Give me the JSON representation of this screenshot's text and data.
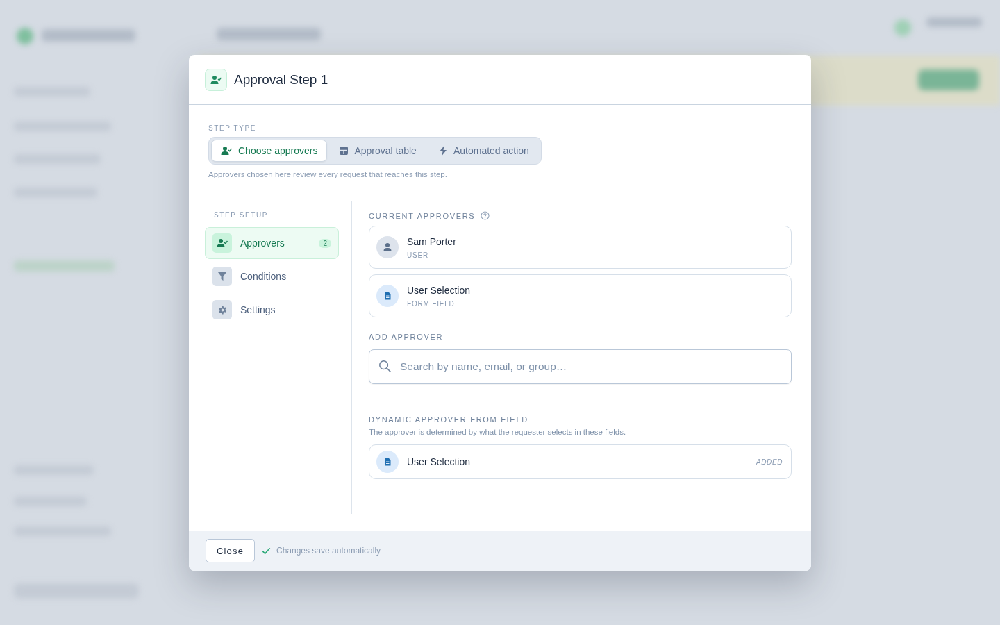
{
  "dialog": {
    "title": "Approval Step 1"
  },
  "step_type": {
    "label": "STEP TYPE",
    "options": [
      {
        "kind": "approvers",
        "label": "Choose approvers",
        "selected": true
      },
      {
        "kind": "table",
        "label": "Approval table",
        "selected": false
      },
      {
        "kind": "automation",
        "label": "Automated action",
        "selected": false
      }
    ],
    "hint": "Approvers chosen here review every request that reaches this step."
  },
  "setup_nav": {
    "label": "STEP SETUP",
    "items": [
      {
        "kind": "approvers",
        "label": "Approvers",
        "count": "2",
        "selected": true
      },
      {
        "kind": "conditions",
        "label": "Conditions",
        "selected": false
      },
      {
        "kind": "settings",
        "label": "Settings",
        "selected": false
      }
    ]
  },
  "current_approvers": {
    "label": "CURRENT APPROVERS",
    "items": [
      {
        "kind": "user",
        "name": "Sam Porter",
        "type": "USER"
      },
      {
        "kind": "field",
        "name": "User Selection",
        "type": "FORM FIELD"
      }
    ]
  },
  "add_approver": {
    "label": "ADD APPROVER",
    "search": {
      "placeholder": "Search by name, email, or group…"
    }
  },
  "dynamic_approver": {
    "label": "DYNAMIC APPROVER FROM FIELD",
    "description": "The approver is determined by what the requester selects in these fields.",
    "fields": [
      {
        "name": "User Selection",
        "status": "ADDED"
      }
    ]
  },
  "footer": {
    "close": "Close",
    "status": "Changes save automatically"
  }
}
